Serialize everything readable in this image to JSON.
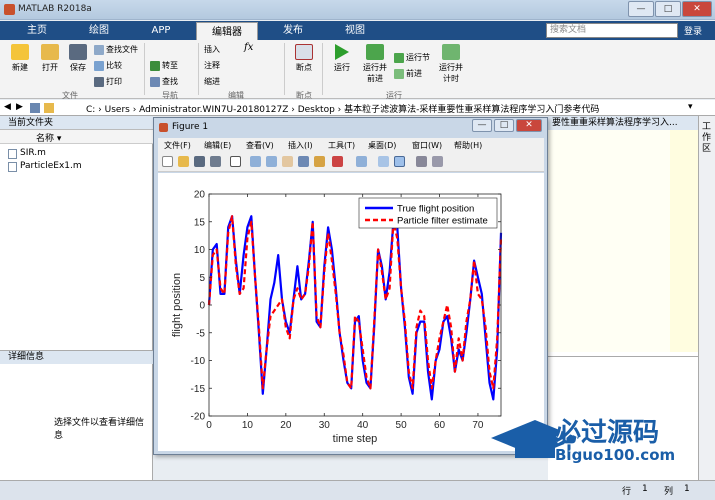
{
  "window": {
    "title": "MATLAB R2018a",
    "min": "—",
    "max": "□",
    "close": "✕"
  },
  "tabs": [
    "主页",
    "绘图",
    "APP",
    "编辑器",
    "发布",
    "视图"
  ],
  "search": {
    "placeholder": "搜索文档"
  },
  "signin": "登录",
  "toolstrip": {
    "file": {
      "new": "新建",
      "open": "打开",
      "save": "保存",
      "find_files": "查找文件",
      "compare": "比较",
      "print": "打印",
      "group": "文件"
    },
    "nav": {
      "goto": "转至",
      "find": "查找",
      "group": "导航"
    },
    "edit": {
      "insert": "插入",
      "fx": "fx",
      "comment": "注释",
      "indent": "缩进",
      "group": "编辑"
    },
    "breakpoints": {
      "label": "断点",
      "group": "断点"
    },
    "run": {
      "run": "运行",
      "run_advance": "运行并前进",
      "run_section": "运行节",
      "advance": "前进",
      "run_time": "运行并计时",
      "group": "运行"
    }
  },
  "address": {
    "path": "C:  ›  Users  ›  Administrator.WIN7U-20180127Z  ›  Desktop  ›  基本粒子滤波算法-采样重要性重采样算法程序学习入门参考代码"
  },
  "left_panel": {
    "title": "当前文件夹",
    "name_header": "名称 ▾",
    "files": [
      "SIR.m",
      "ParticleEx1.m"
    ]
  },
  "details": {
    "title": "详细信息",
    "hint": "选择文件以查看详细信息"
  },
  "right": {
    "tab_label": "要性重重采样算法程序学习入...",
    "workspace": "工作区"
  },
  "status": {
    "row_label": "行",
    "row": "1",
    "col_label": "列",
    "col": "1"
  },
  "figure": {
    "title": "Figure 1",
    "menu": [
      "文件(F)",
      "编辑(E)",
      "查看(V)",
      "插入(I)",
      "工具(T)",
      "桌面(D)",
      "窗口(W)",
      "帮助(H)"
    ]
  },
  "watermark": {
    "text": "必过源码",
    "url": "Biguo100.com"
  },
  "colors": {
    "true_line": "#0000ff",
    "estimate_line": "#ff0000",
    "tab_bar": "#1f4e86"
  },
  "chart_data": {
    "type": "line",
    "xlabel": "time step",
    "ylabel": "flight position",
    "xlim": [
      0,
      76
    ],
    "ylim": [
      -20,
      20
    ],
    "xticks": [
      0,
      10,
      20,
      30,
      40,
      50,
      60,
      70
    ],
    "yticks": [
      -20,
      -15,
      -10,
      -5,
      0,
      5,
      10,
      15,
      20
    ],
    "legend_position": "top-right",
    "series": [
      {
        "name": "True flight position",
        "color": "#0000ff",
        "style": "solid",
        "x": [
          0,
          1,
          2,
          3,
          4,
          5,
          6,
          7,
          8,
          9,
          10,
          11,
          12,
          13,
          14,
          15,
          16,
          17,
          18,
          19,
          20,
          21,
          22,
          23,
          24,
          25,
          26,
          27,
          28,
          29,
          30,
          31,
          32,
          33,
          34,
          35,
          36,
          37,
          38,
          39,
          40,
          41,
          42,
          43,
          44,
          45,
          46,
          47,
          48,
          49,
          50,
          51,
          52,
          53,
          54,
          55,
          56,
          57,
          58,
          59,
          60,
          61,
          62,
          63,
          64,
          65,
          66,
          67,
          68,
          69,
          70,
          71,
          72,
          73,
          74,
          75,
          76
        ],
        "y": [
          0,
          10,
          11,
          2,
          2,
          14,
          16,
          8,
          2,
          9,
          14,
          16,
          5,
          -5,
          -16,
          -8,
          1,
          4,
          9,
          1,
          -3,
          -5,
          1,
          7,
          1,
          2,
          8,
          15,
          -3,
          -4,
          7,
          14,
          10,
          3,
          -5,
          -10,
          -14,
          -15,
          -3,
          -2,
          -10,
          -14,
          -15,
          -4,
          10,
          7,
          1,
          6,
          15,
          14,
          3,
          -4,
          -13,
          -16,
          -5,
          -3,
          -3,
          -12,
          -17,
          -10,
          -8,
          -3,
          -2,
          -6,
          -12,
          -8,
          -10,
          -5,
          1,
          8,
          5,
          2,
          -6,
          -14,
          -17,
          -8,
          13
        ]
      },
      {
        "name": "Particle filter estimate",
        "color": "#ff0000",
        "style": "dashed",
        "x": [
          0,
          1,
          2,
          3,
          4,
          5,
          6,
          7,
          8,
          9,
          10,
          11,
          12,
          13,
          14,
          15,
          16,
          17,
          18,
          19,
          20,
          21,
          22,
          23,
          24,
          25,
          26,
          27,
          28,
          29,
          30,
          31,
          32,
          33,
          34,
          35,
          36,
          37,
          38,
          39,
          40,
          41,
          42,
          43,
          44,
          45,
          46,
          47,
          48,
          49,
          50,
          51,
          52,
          53,
          54,
          55,
          56,
          57,
          58,
          59,
          60,
          61,
          62,
          63,
          64,
          65,
          66,
          67,
          68,
          69,
          70,
          71,
          72,
          73,
          74,
          75,
          76
        ],
        "y": [
          0,
          9,
          10,
          3,
          2,
          13,
          16,
          7,
          2,
          3,
          12,
          15,
          5,
          -4,
          -15,
          -8,
          -2,
          -1,
          0,
          1,
          -4,
          -6,
          1,
          3,
          1,
          2,
          7,
          15,
          -2,
          -4,
          6,
          13,
          8,
          2,
          -5,
          -9,
          -14,
          -15,
          -2,
          -3,
          -8,
          -13,
          -15,
          -3,
          10,
          6,
          1,
          3,
          15,
          12,
          3,
          -3,
          -12,
          -15,
          -4,
          -1,
          -2,
          -10,
          -15,
          -10,
          -6,
          -3,
          0,
          -4,
          -12,
          -6,
          -10,
          -3,
          1,
          8,
          2,
          1,
          -4,
          -12,
          -15,
          -6,
          12
        ]
      }
    ]
  }
}
